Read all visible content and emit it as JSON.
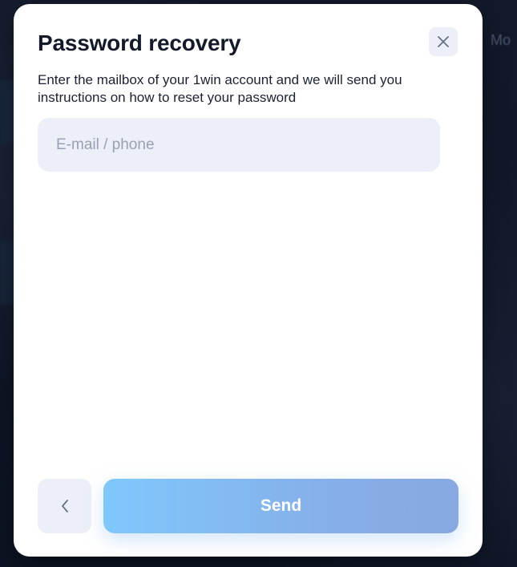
{
  "background": {
    "edge_text": "Mo"
  },
  "modal": {
    "title": "Password recovery",
    "description": "Enter the mailbox of your 1win account and we will send you instructions on how to reset your password",
    "close_icon": "close-icon",
    "email_field": {
      "value": "",
      "placeholder": "E-mail / phone"
    },
    "back_icon": "chevron-left-icon",
    "send_label": "Send"
  },
  "colors": {
    "primary_gradient_start": "#7fc8fb",
    "primary_gradient_end": "#87a8e1",
    "field_background": "#eceff8",
    "title_color": "#141a2a"
  }
}
